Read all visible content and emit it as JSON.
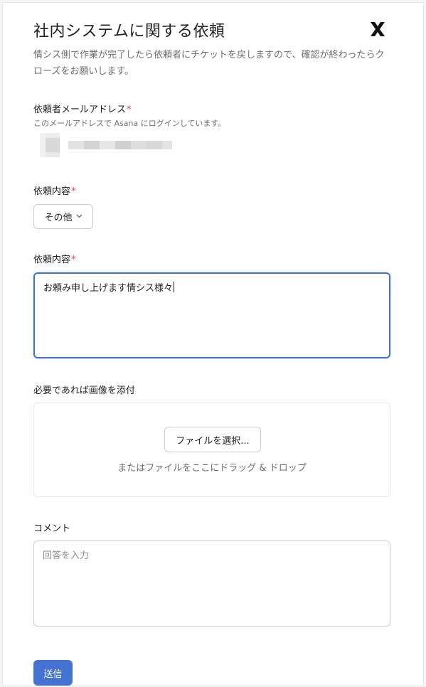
{
  "form": {
    "title": "社内システムに関する依頼",
    "description": "情シス側で作業が完了したら依頼者にチケットを戻しますので、確認が終わったらクローズをお願いします。",
    "logo_icon": "x-logo-icon"
  },
  "email_field": {
    "label": "依頼者メールアドレス",
    "required_mark": "*",
    "hint": "このメールアドレスで Asana にログインしています。"
  },
  "category_field": {
    "label": "依頼内容",
    "required_mark": "*",
    "selected": "その他",
    "chevron_icon": "chevron-down-icon"
  },
  "request_field": {
    "label": "依頼内容",
    "required_mark": "*",
    "value": "お頼み申し上げます情シス様々"
  },
  "attachment_field": {
    "label": "必要であれば画像を添付",
    "button_label": "ファイルを選択...",
    "drop_hint": "またはファイルをここにドラッグ & ドロップ"
  },
  "comment_field": {
    "label": "コメント",
    "placeholder": "回答を入力"
  },
  "submit": {
    "label": "送信"
  },
  "colors": {
    "accent": "#4573d2",
    "required": "#e8384f",
    "muted_text": "#6d6e6f"
  }
}
